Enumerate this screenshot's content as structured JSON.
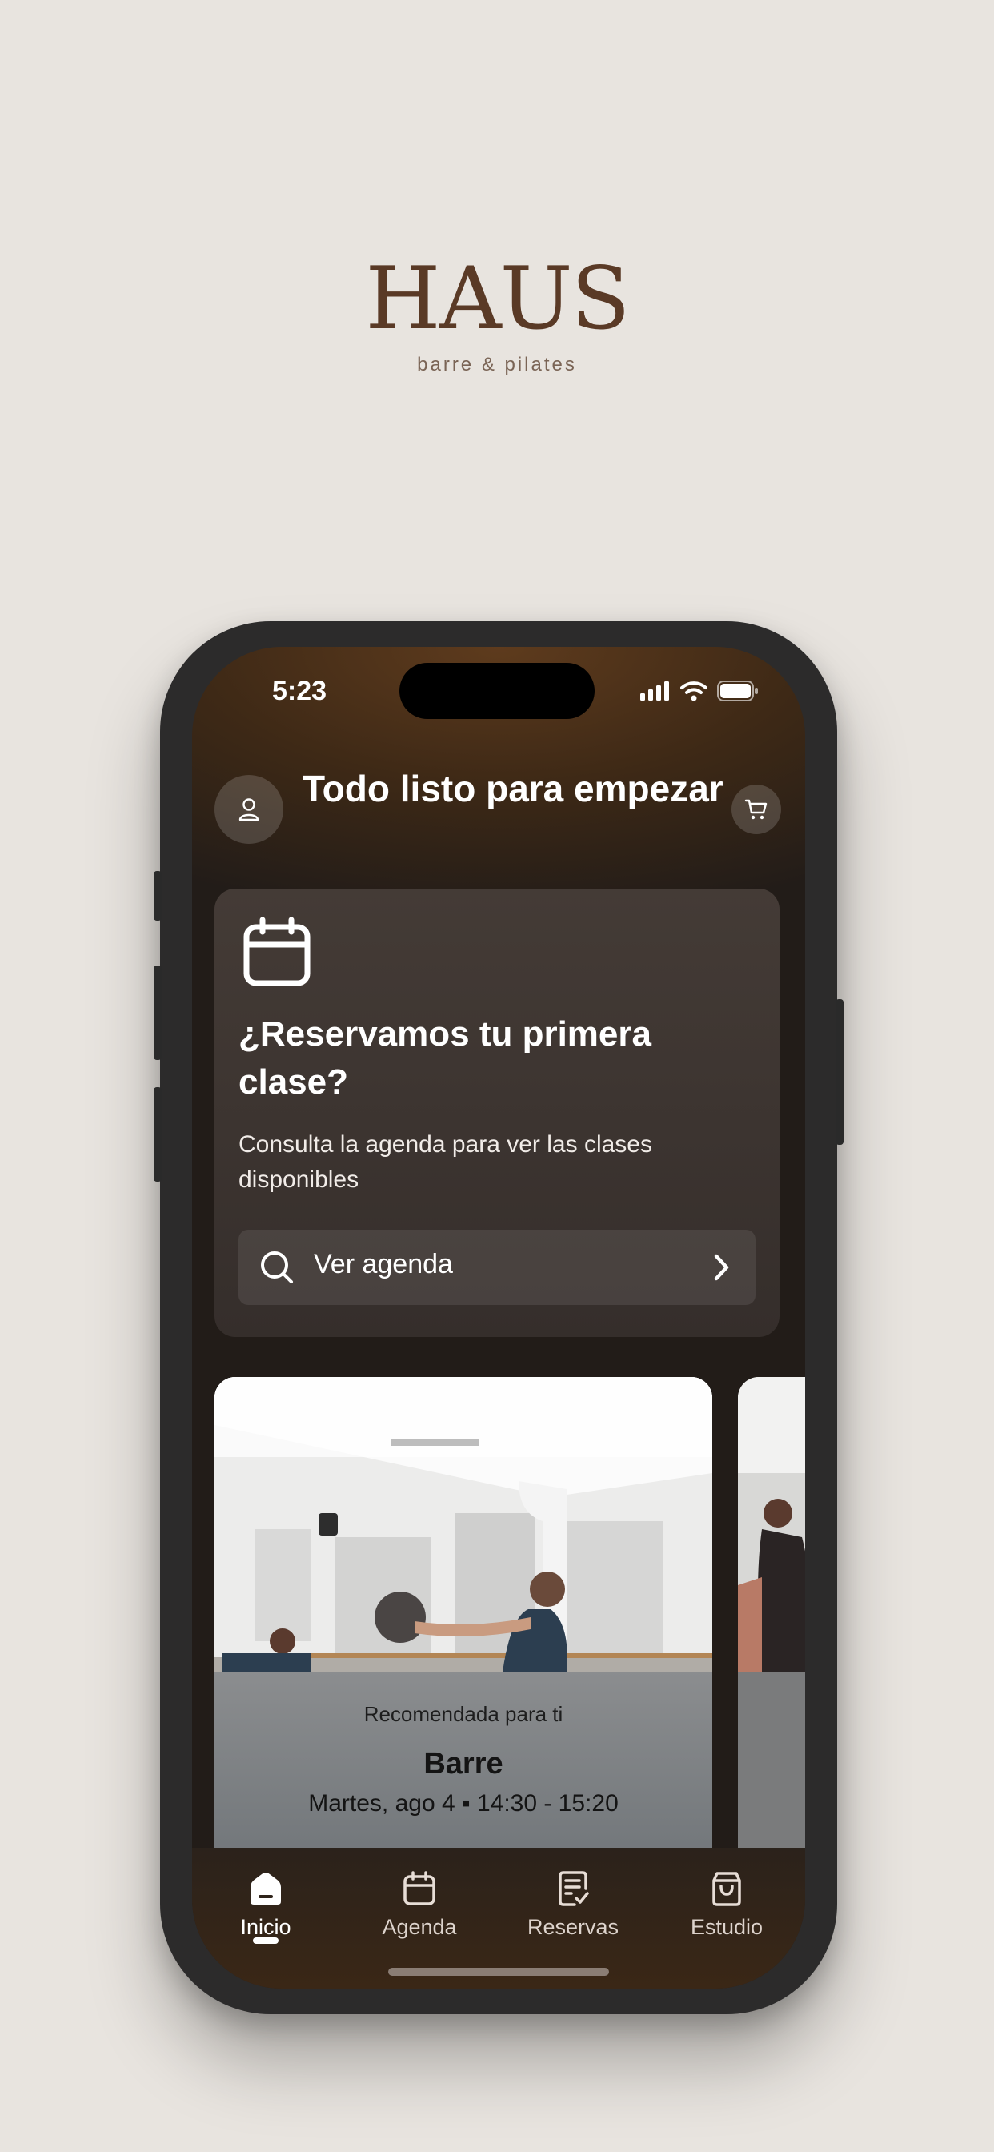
{
  "brand": {
    "name": "HAUS",
    "tagline": "barre & pilates"
  },
  "status_bar": {
    "time": "5:23"
  },
  "header": {
    "title": "Todo listo para empezar"
  },
  "promo_card": {
    "icon": "calendar-icon",
    "title": "¿Reservamos tu primera clase?",
    "description": "Consulta la agenda para ver las clases disponibles",
    "button_label": "Ver agenda"
  },
  "recommended_class": {
    "badge": "Recomendada para ti",
    "name": "Barre",
    "schedule": "Martes, ago 4 ▪ 14:30 - 15:20"
  },
  "tabs": [
    {
      "label": "Inicio",
      "icon": "home-icon",
      "active": true
    },
    {
      "label": "Agenda",
      "icon": "calendar-icon",
      "active": false
    },
    {
      "label": "Reservas",
      "icon": "bookings-icon",
      "active": false
    },
    {
      "label": "Estudio",
      "icon": "shopping-bag-icon",
      "active": false
    }
  ]
}
